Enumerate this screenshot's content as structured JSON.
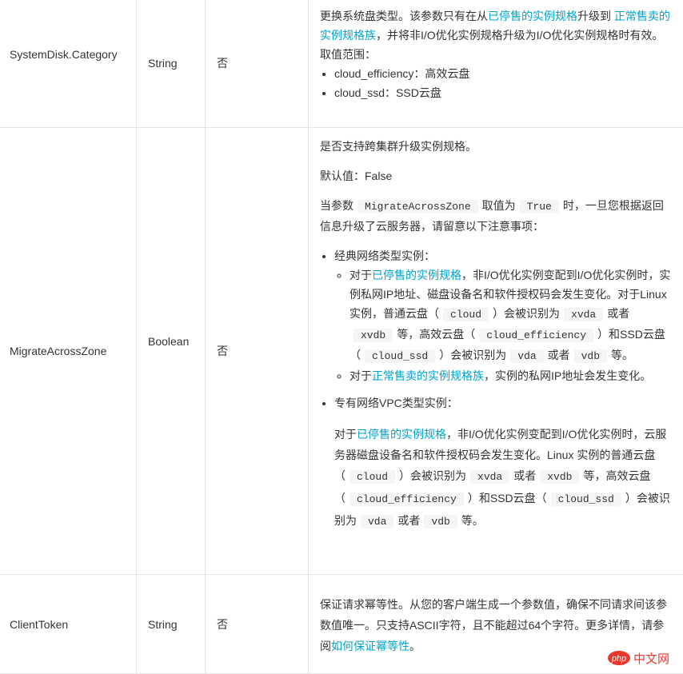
{
  "rows": [
    {
      "name": "SystemDisk.Category",
      "type": "String",
      "required": "否",
      "desc": {
        "p1_a": "更换系统盘类型。该参数只有在从",
        "p1_link1": "已停售的实例规格",
        "p1_b": "升级到 ",
        "p1_link2": "正常售卖的实例规格族",
        "p1_c": "，并将非I/O优化实例规格升级为I/O优化实例规格时有效。取值范围：",
        "items": [
          "cloud_efficiency：高效云盘",
          "cloud_ssd：SSD云盘"
        ]
      }
    },
    {
      "name": "MigrateAcrossZone",
      "type": "Boolean",
      "required": "否",
      "desc": {
        "p1": "是否支持跨集群升级实例规格。",
        "p2": "默认值：False",
        "p3_a": "当参数",
        "p3_code1": "MigrateAcrossZone",
        "p3_b": "取值为",
        "p3_code2": "True",
        "p3_c": "时，一旦您根据返回信息升级了云服务器，请留意以下注意事项：",
        "classic_title": "经典网络类型实例：",
        "classic_1_a": "对于",
        "classic_1_link": "已停售的实例规格",
        "classic_1_b": "，非I/O优化实例变配到I/O优化实例时，实例私网IP地址、磁盘设备名和软件授权码会发生变化。对于Linux实例，普通云盘（",
        "classic_1_code1": "cloud",
        "classic_1_c": "）会被识别为",
        "classic_1_code2": "xvda",
        "classic_1_d": "或者",
        "classic_1_code3": "xvdb",
        "classic_1_e": "等，高效云盘（",
        "classic_1_code4": "cloud_efficiency",
        "classic_1_f": "）和SSD云盘（",
        "classic_1_code5": "cloud_ssd",
        "classic_1_g": "）会被识别为",
        "classic_1_code6": "vda",
        "classic_1_h": "或者",
        "classic_1_code7": "vdb",
        "classic_1_i": "等。",
        "classic_2_a": "对于",
        "classic_2_link": "正常售卖的实例规格族",
        "classic_2_b": "，实例的私网IP地址会发生变化。",
        "vpc_title": "专有网络VPC类型实例：",
        "vpc_a": "对于",
        "vpc_link": "已停售的实例规格",
        "vpc_b": "，非I/O优化实例变配到I/O优化实例时，云服务器磁盘设备名和软件授权码会发生变化。Linux 实例的普通云盘（",
        "vpc_code1": "cloud",
        "vpc_c": "）会被识别为",
        "vpc_code2": "xvda",
        "vpc_d": "或者",
        "vpc_code3": "xvdb",
        "vpc_e": "等，高效云盘（",
        "vpc_code4": "cloud_efficiency",
        "vpc_f": "）和SSD云盘（",
        "vpc_code5": "cloud_ssd",
        "vpc_g": "）会被识别为",
        "vpc_code6": "vda",
        "vpc_h": "或者",
        "vpc_code7": "vdb",
        "vpc_i": "等。"
      }
    },
    {
      "name": "ClientToken",
      "type": "String",
      "required": "否",
      "desc": {
        "p1_a": "保证请求幂等性。从您的客户端生成一个参数值，确保不同请求间该参数值唯一。只支持ASCII字符，且不能超过64个字符。更多详情，请参阅",
        "p1_link": "如何保证幂等性",
        "p1_b": "。"
      }
    }
  ],
  "watermark": {
    "logo": "php",
    "text": "中文网"
  },
  "colors": {
    "link": "#00a2ca",
    "border": "#e4e4e4",
    "text": "#333333",
    "code_bg": "#f5f5f5"
  }
}
